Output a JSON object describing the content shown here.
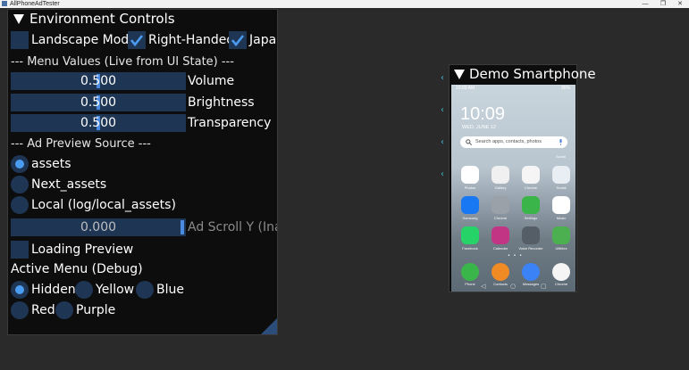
{
  "os_window": {
    "title": "AllPhoneAdTester",
    "minimize": "—",
    "maximize": "❐",
    "close": "✕"
  },
  "env": {
    "title": "Environment Controls",
    "checkboxes": [
      {
        "label": "Landscape Mode",
        "checked": false
      },
      {
        "label": "Right-Handed",
        "checked": true
      },
      {
        "label": "Japan",
        "checked": true
      }
    ],
    "menu_values_header": "--- Menu Values (Live from UI State) ---",
    "sliders": [
      {
        "value": "0.500",
        "label": "Volume",
        "fraction": 0.5
      },
      {
        "value": "0.500",
        "label": "Brightness",
        "fraction": 0.5
      },
      {
        "value": "0.500",
        "label": "Transparency",
        "fraction": 0.5
      }
    ],
    "ad_source_header": "--- Ad Preview Source ---",
    "ad_sources": [
      {
        "label": "assets",
        "selected": true
      },
      {
        "label": "Next_assets",
        "selected": false
      },
      {
        "label": "Local (log/local_assets)",
        "selected": false
      }
    ],
    "ad_scroll": {
      "value": "0.000",
      "label": "Ad Scroll Y (Inact"
    },
    "loading_preview": {
      "label": "Loading Preview",
      "checked": false
    },
    "active_menu_label": "Active Menu (Debug)",
    "active_menu_options": [
      {
        "label": "Hidden",
        "selected": true
      },
      {
        "label": "Yellow",
        "selected": false
      },
      {
        "label": "Blue",
        "selected": false
      },
      {
        "label": "Red",
        "selected": false
      },
      {
        "label": "Purple",
        "selected": false
      }
    ]
  },
  "phone": {
    "title": "Demo Smartphone",
    "status_time": "10:09 AM",
    "status_right": "95%",
    "clock": "10:09",
    "date": "WED, JUNE 12",
    "search_placeholder": "Search apps, contacts, photos",
    "folder_label": "Social",
    "apps": [
      {
        "label": "Photos",
        "color": "#ffffff"
      },
      {
        "label": "Gallery",
        "color": "#f0f0f0"
      },
      {
        "label": "Chrome",
        "color": "#f5f5f5"
      },
      {
        "label": "Social",
        "color": "#e9eef5"
      },
      {
        "label": "Samsung",
        "color": "#1877f2"
      },
      {
        "label": "Chrome",
        "color": "#9aa1a8"
      },
      {
        "label": "Settings",
        "color": "#3ab54a"
      },
      {
        "label": "Music",
        "color": "#ffffff"
      },
      {
        "label": "Facebook",
        "color": "#25d366"
      },
      {
        "label": "Calendar",
        "color": "#c13584"
      },
      {
        "label": "Voice Recorder",
        "color": "#555d66"
      },
      {
        "label": "Utilities",
        "color": "#4caf50"
      }
    ],
    "dock": [
      {
        "label": "Phone",
        "color": "#3ab54a"
      },
      {
        "label": "Contacts",
        "color": "#f08a24"
      },
      {
        "label": "Messages",
        "color": "#3b82f6"
      },
      {
        "label": "Chrome",
        "color": "#f5f5f5"
      }
    ],
    "nav": [
      "◁",
      "○",
      "▢"
    ]
  },
  "edge_arrows": [
    "‹",
    "‹",
    "‹",
    "‹"
  ]
}
